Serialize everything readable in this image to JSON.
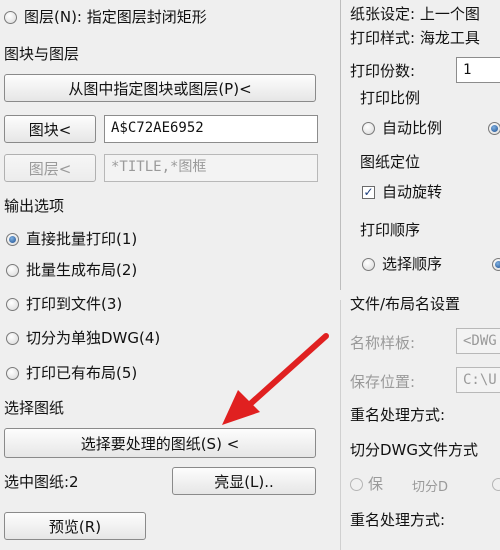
{
  "left": {
    "top_option_label": "图层(N): 指定图层封闭矩形",
    "blocks_section_title": "图块与图层",
    "pick_button": "从图中指定图块或图层(P)<",
    "block_button": "图块<",
    "block_value": "A$C72AE6952",
    "layer_button": "图层<",
    "layer_value": "*TITLE,*图框",
    "output_section_title": "输出选项",
    "output_options": [
      "直接批量打印(1)",
      "批量生成布局(2)",
      "打印到文件(3)",
      "切分为单独DWG(4)",
      "打印已有布局(5)"
    ],
    "select_section_title": "选择图纸",
    "select_button": "选择要处理的图纸(S) <",
    "selected_count_label": "选中图纸:2",
    "highlight_button": "亮显(L)..",
    "preview_button": "预览(R)"
  },
  "right": {
    "paper_setting": "纸张设定: 上一个图",
    "plot_style": "打印样式: 海龙工具",
    "copies_label": "打印份数:",
    "copies_value": "1",
    "scale_title": "打印比例",
    "auto_scale_label": "自动比例",
    "position_title": "图纸定位",
    "auto_rotate_label": "自动旋转",
    "order_title": "打印顺序",
    "select_order_label": "选择顺序",
    "file_section_title": "文件/布局名设置",
    "name_template_label": "名称样板:",
    "name_template_value": "<DWG",
    "save_location_label": "保存位置:",
    "save_location_value": "C:\\U",
    "rename_label_1": "重名处理方式:",
    "split_section_title": "切分DWG文件方式",
    "split_partial_label": "保",
    "split_partial_label_2": "切分D",
    "rename_label_2": "重名处理方式:"
  },
  "colors": {
    "arrow": "#e02020",
    "radio_fill": "#1d4f91"
  }
}
